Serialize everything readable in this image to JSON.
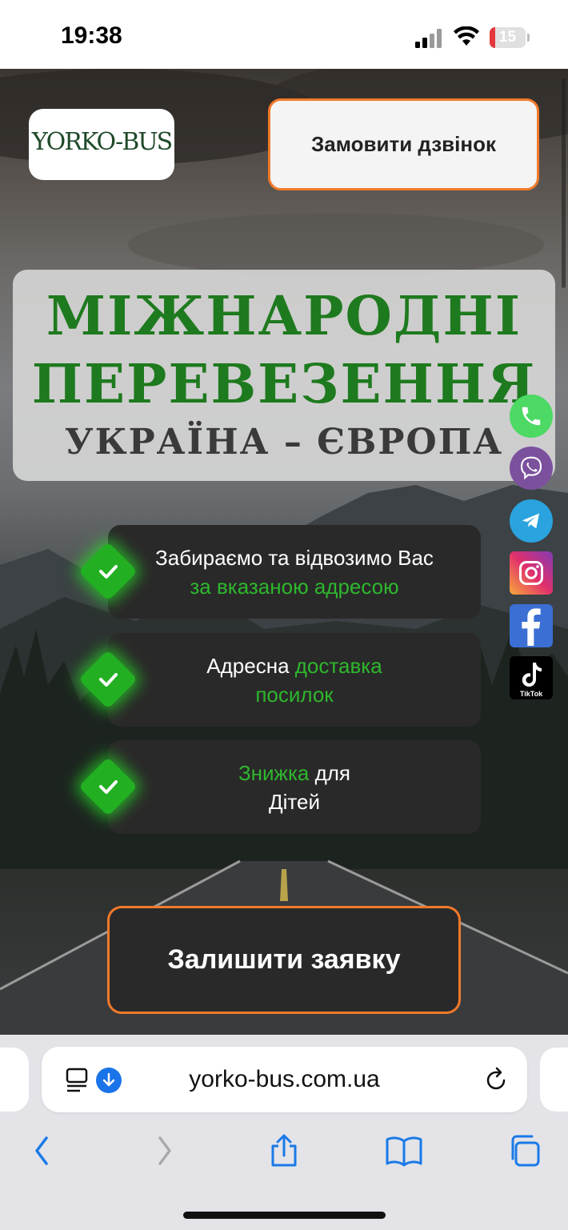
{
  "status_bar": {
    "time": "19:38",
    "battery": "15",
    "battery_level": 0.15
  },
  "header": {
    "logo_text": "YORKO-BUS",
    "call_button": "Замовити дзвінок"
  },
  "hero": {
    "title_line1": "МІЖНАРОДНІ",
    "title_line2": "ПЕРЕВЕЗЕННЯ",
    "title_line3": "УКРАЇНА – ЄВРОПА"
  },
  "features": [
    {
      "text": "Забираємо та відвозимо Вас ",
      "highlight": "за вказаною адресою"
    },
    {
      "text": "Адресна ",
      "highlight": "доставка посилок"
    },
    {
      "highlight": "Знижка",
      "text": " для Дітей"
    }
  ],
  "apply_button": "Залишити заявку",
  "social": {
    "items": [
      "phone-icon",
      "viber-icon",
      "telegram-icon",
      "instagram-icon",
      "facebook-icon",
      "tiktok-icon"
    ],
    "tiktok_label": "TikTok",
    "colors": {
      "phone": "#4cd964",
      "viber": "#7b519d",
      "telegram": "#2aa3df",
      "instagram": "#e1306c",
      "facebook": "#1877f2",
      "tiktok": "#000000"
    }
  },
  "browser": {
    "url": "yorko-bus.com.ua"
  },
  "colors": {
    "accent_green": "#1e7a1e",
    "highlight_green": "#2db82d",
    "button_border": "#f07a2a",
    "card_bg": "#2a2929"
  }
}
